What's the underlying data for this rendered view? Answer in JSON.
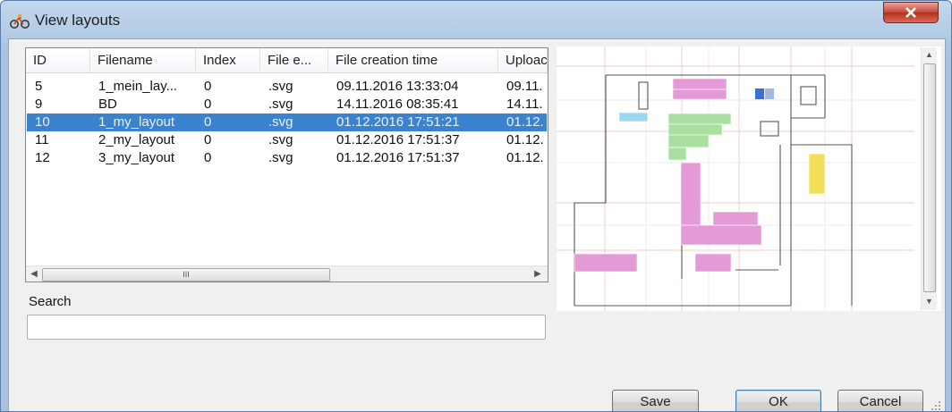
{
  "window": {
    "title": "View layouts",
    "app_icon": "bicycle-icon",
    "close_icon": "close-icon"
  },
  "list": {
    "columns": [
      "ID",
      "Filename",
      "Index",
      "File e...",
      "File creation time",
      "Uploac"
    ],
    "rows": [
      {
        "id": "5",
        "filename": "1_mein_lay...",
        "index": "0",
        "ext": ".svg",
        "created": "09.11.2016 13:33:04",
        "upload": "09.11."
      },
      {
        "id": "9",
        "filename": "BD",
        "index": "0",
        "ext": ".svg",
        "created": "14.11.2016 08:35:41",
        "upload": "14.11."
      },
      {
        "id": "10",
        "filename": "1_my_layout",
        "index": "0",
        "ext": ".svg",
        "created": "01.12.2016 17:51:21",
        "upload": "01.12."
      },
      {
        "id": "11",
        "filename": "2_my_layout",
        "index": "0",
        "ext": ".svg",
        "created": "01.12.2016 17:51:37",
        "upload": "01.12."
      },
      {
        "id": "12",
        "filename": "3_my_layout",
        "index": "0",
        "ext": ".svg",
        "created": "01.12.2016 17:51:37",
        "upload": "01.12."
      }
    ],
    "selected_index": 2,
    "hscroll_grip": "III"
  },
  "search": {
    "label": "Search",
    "value": "",
    "placeholder": ""
  },
  "buttons": {
    "save": "Save",
    "ok": "OK",
    "cancel": "Cancel"
  },
  "colors": {
    "selection": "#3b83cc",
    "pink": "#e39ad7",
    "green": "#a9e0a0",
    "cyan": "#9ad8ee",
    "yellow": "#f2e05a",
    "blue": "#3b6fd1"
  }
}
